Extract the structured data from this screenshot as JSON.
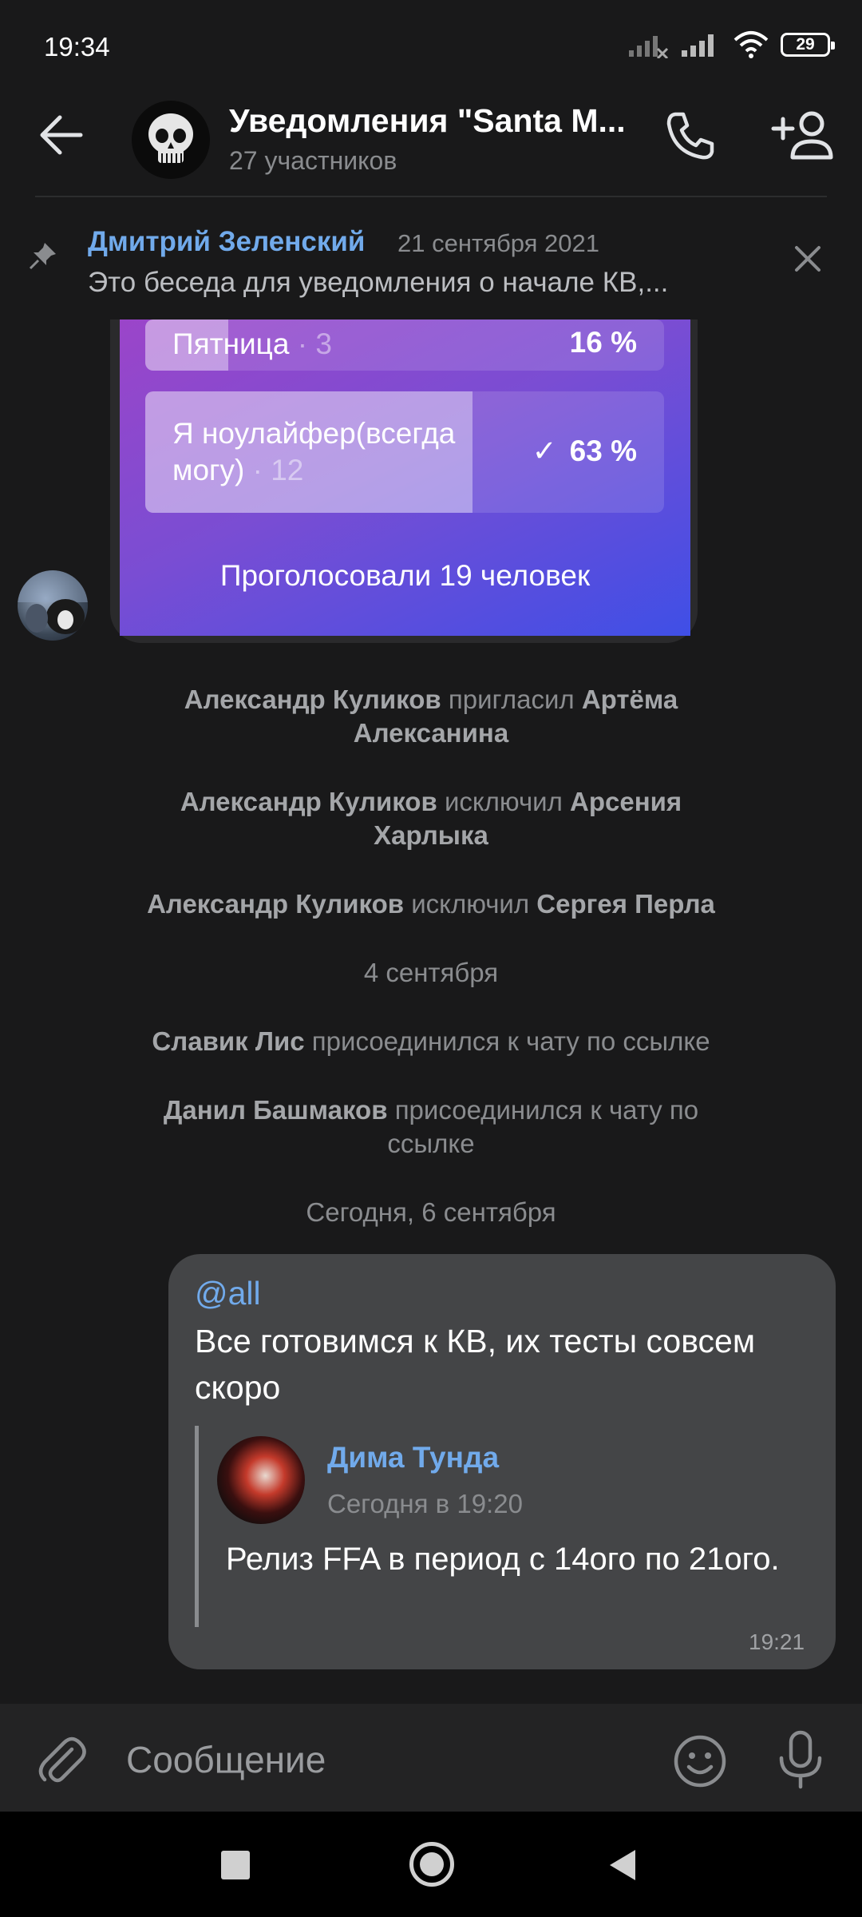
{
  "status_bar": {
    "time": "19:34",
    "battery": "29"
  },
  "header": {
    "title": "Уведомления \"Santa M...",
    "subtitle": "27 участников"
  },
  "pinned": {
    "author": "Дмитрий Зеленский",
    "date": "21 сентября 2021",
    "text": "Это беседа для уведомления о начале КВ,..."
  },
  "poll": {
    "options": [
      {
        "label": "Пятница",
        "count": "· 3",
        "percent": "16 %",
        "fill": 0.16,
        "checked": false
      },
      {
        "label_line1": "Я ноулайфер(всегда",
        "label_line2": "могу)",
        "count": "· 12",
        "check": "✓",
        "percent": "63 %",
        "fill": 0.63,
        "checked": true
      }
    ],
    "total": "Проголосовали 19 человек"
  },
  "service_messages": [
    {
      "actor": "Александр Куликов",
      "action": "пригласил",
      "target_line1": "Артёма",
      "target_line2": "Алексанина"
    },
    {
      "actor": "Александр Куликов",
      "action": "исключил",
      "target_line1": "Арсения",
      "target_line2": "Харлыка"
    },
    {
      "actor": "Александр Куликов",
      "action": "исключил",
      "target": "Сергея Перла"
    },
    {
      "date": "4 сентября"
    },
    {
      "actor": "Славик Лис",
      "action": "присоединился к чату по ссылке"
    },
    {
      "actor": "Данил Башмаков",
      "action_line1": "присоединился к чату по",
      "action_line2": "ссылке"
    },
    {
      "date": "Сегодня, 6 сентября"
    }
  ],
  "message": {
    "mention": "@all",
    "text": "Все готовимся к КВ, их тесты совсем скоро",
    "forwarded": {
      "author": "Дима Тунда",
      "time": "Сегодня в 19:20",
      "text": "Релиз FFA в период с 14ого по 21ого."
    },
    "time": "19:21"
  },
  "input": {
    "placeholder": "Сообщение"
  },
  "colors": {
    "accent": "#71aaeb",
    "background": "#19191a",
    "bubble": "#444547"
  }
}
